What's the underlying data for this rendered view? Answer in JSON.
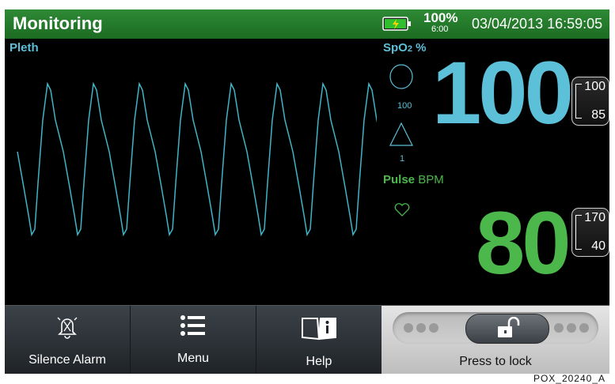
{
  "header": {
    "title": "Monitoring",
    "battery_percent": "100%",
    "battery_time": "6:00",
    "datetime": "03/04/2013 16:59:05"
  },
  "pleth": {
    "label": "Pleth"
  },
  "spo2": {
    "label_main": "SpO",
    "label_sub": "2",
    "label_unit": " %",
    "value": "100",
    "indicator_high": "100",
    "indicator_low": "1",
    "alarm_high": "100",
    "alarm_low": "85"
  },
  "pulse": {
    "label_main": "Pulse",
    "label_unit": " BPM",
    "value": "80",
    "alarm_high": "170",
    "alarm_low": "40"
  },
  "buttons": {
    "silence_alarm": "Silence Alarm",
    "menu": "Menu",
    "help": "Help",
    "lock": "Press to lock"
  },
  "caption": "POX_20240_A",
  "colors": {
    "header": "#1f7028",
    "spo2": "#5bc0d8",
    "pulse": "#4cb84c"
  }
}
